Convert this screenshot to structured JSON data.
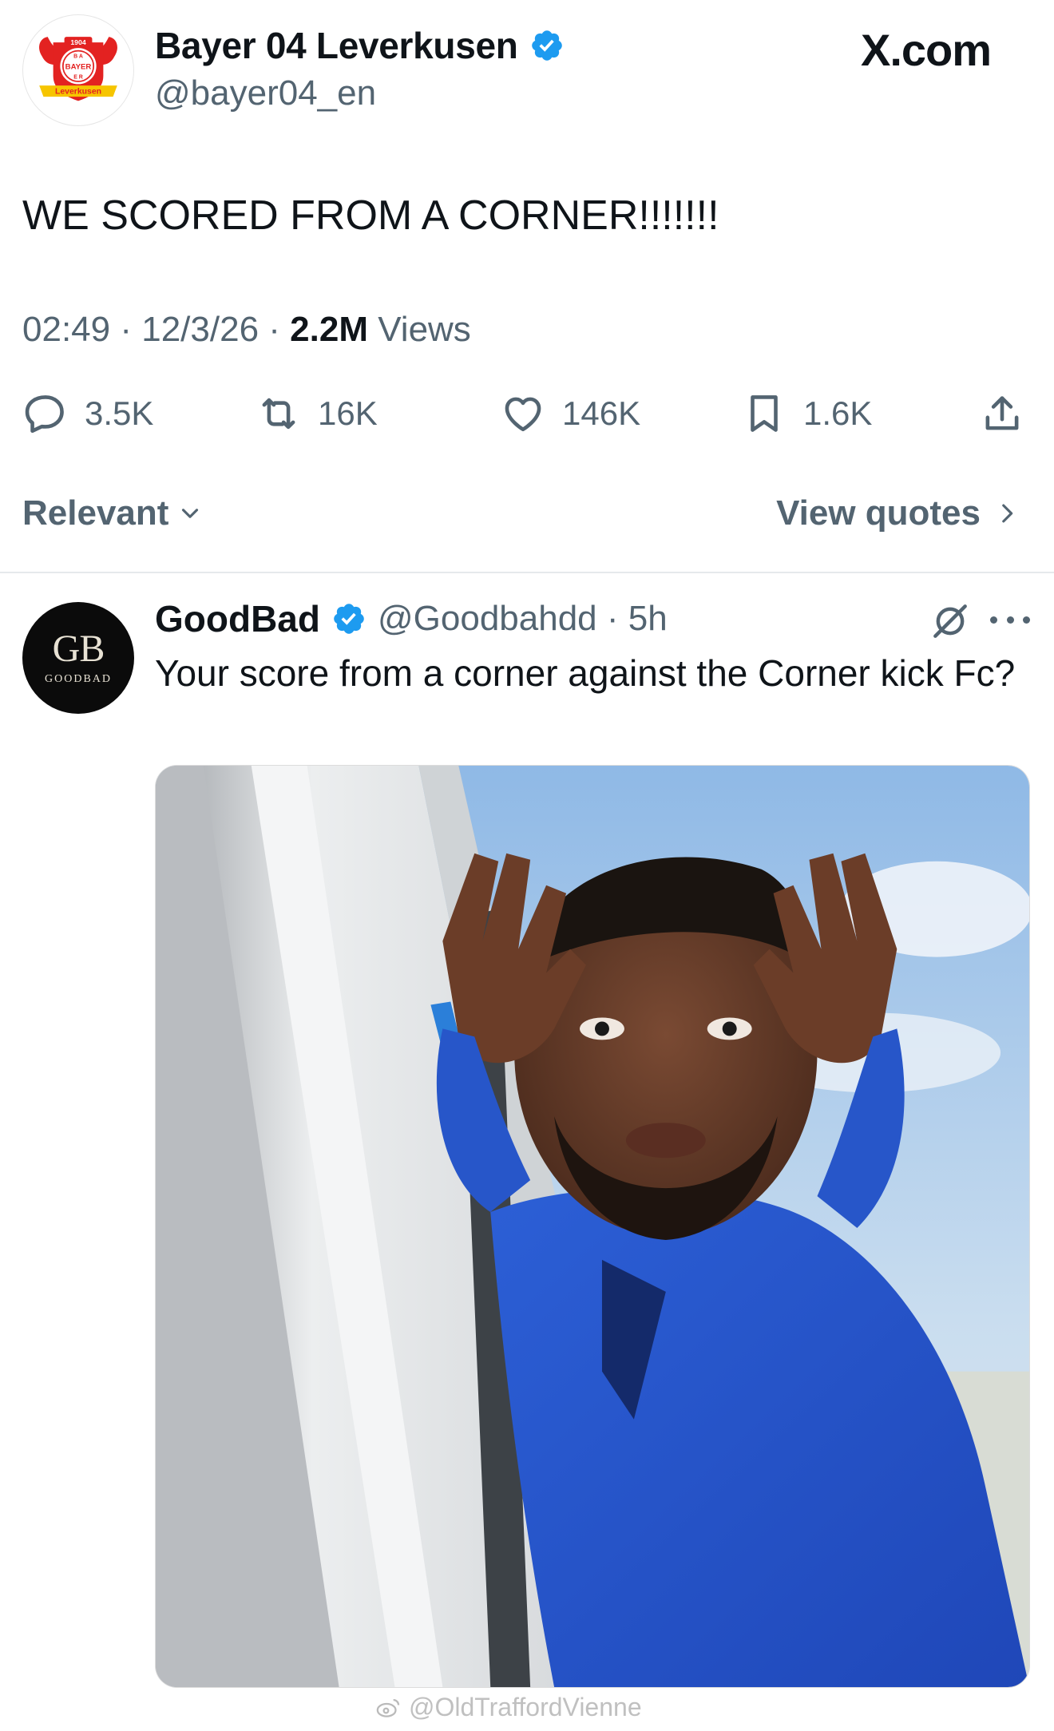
{
  "colors": {
    "text_primary": "#0f1419",
    "text_secondary": "#536471",
    "verified_blue": "#1d9bf0",
    "bayer_red": "#e32221"
  },
  "site_label": "X.com",
  "tweet": {
    "author_name": "Bayer 04 Leverkusen",
    "author_handle": "@bayer04_en",
    "avatar_texts": {
      "year": "1904",
      "brand": "BAYER",
      "city": "Leverkusen"
    },
    "text": "WE SCORED FROM A CORNER!!!!!!!",
    "time": "02:49",
    "date": "12/3/26",
    "views_count": "2.2M",
    "views_label": "Views",
    "actions": {
      "replies": "3.5K",
      "reposts": "16K",
      "likes": "146K",
      "bookmarks": "1.6K"
    }
  },
  "controls": {
    "sort_label": "Relevant",
    "view_quotes_label": "View quotes"
  },
  "reply": {
    "author_name": "GoodBad",
    "author_handle": "@Goodbahdd",
    "time_ago": "5h",
    "avatar_monogram": "GB",
    "avatar_word": "GOODBAD",
    "text": "Your score from a corner against the Corner kick Fc?",
    "image_icon": "meme-photo"
  },
  "watermark": "@OldTraffordVienne"
}
